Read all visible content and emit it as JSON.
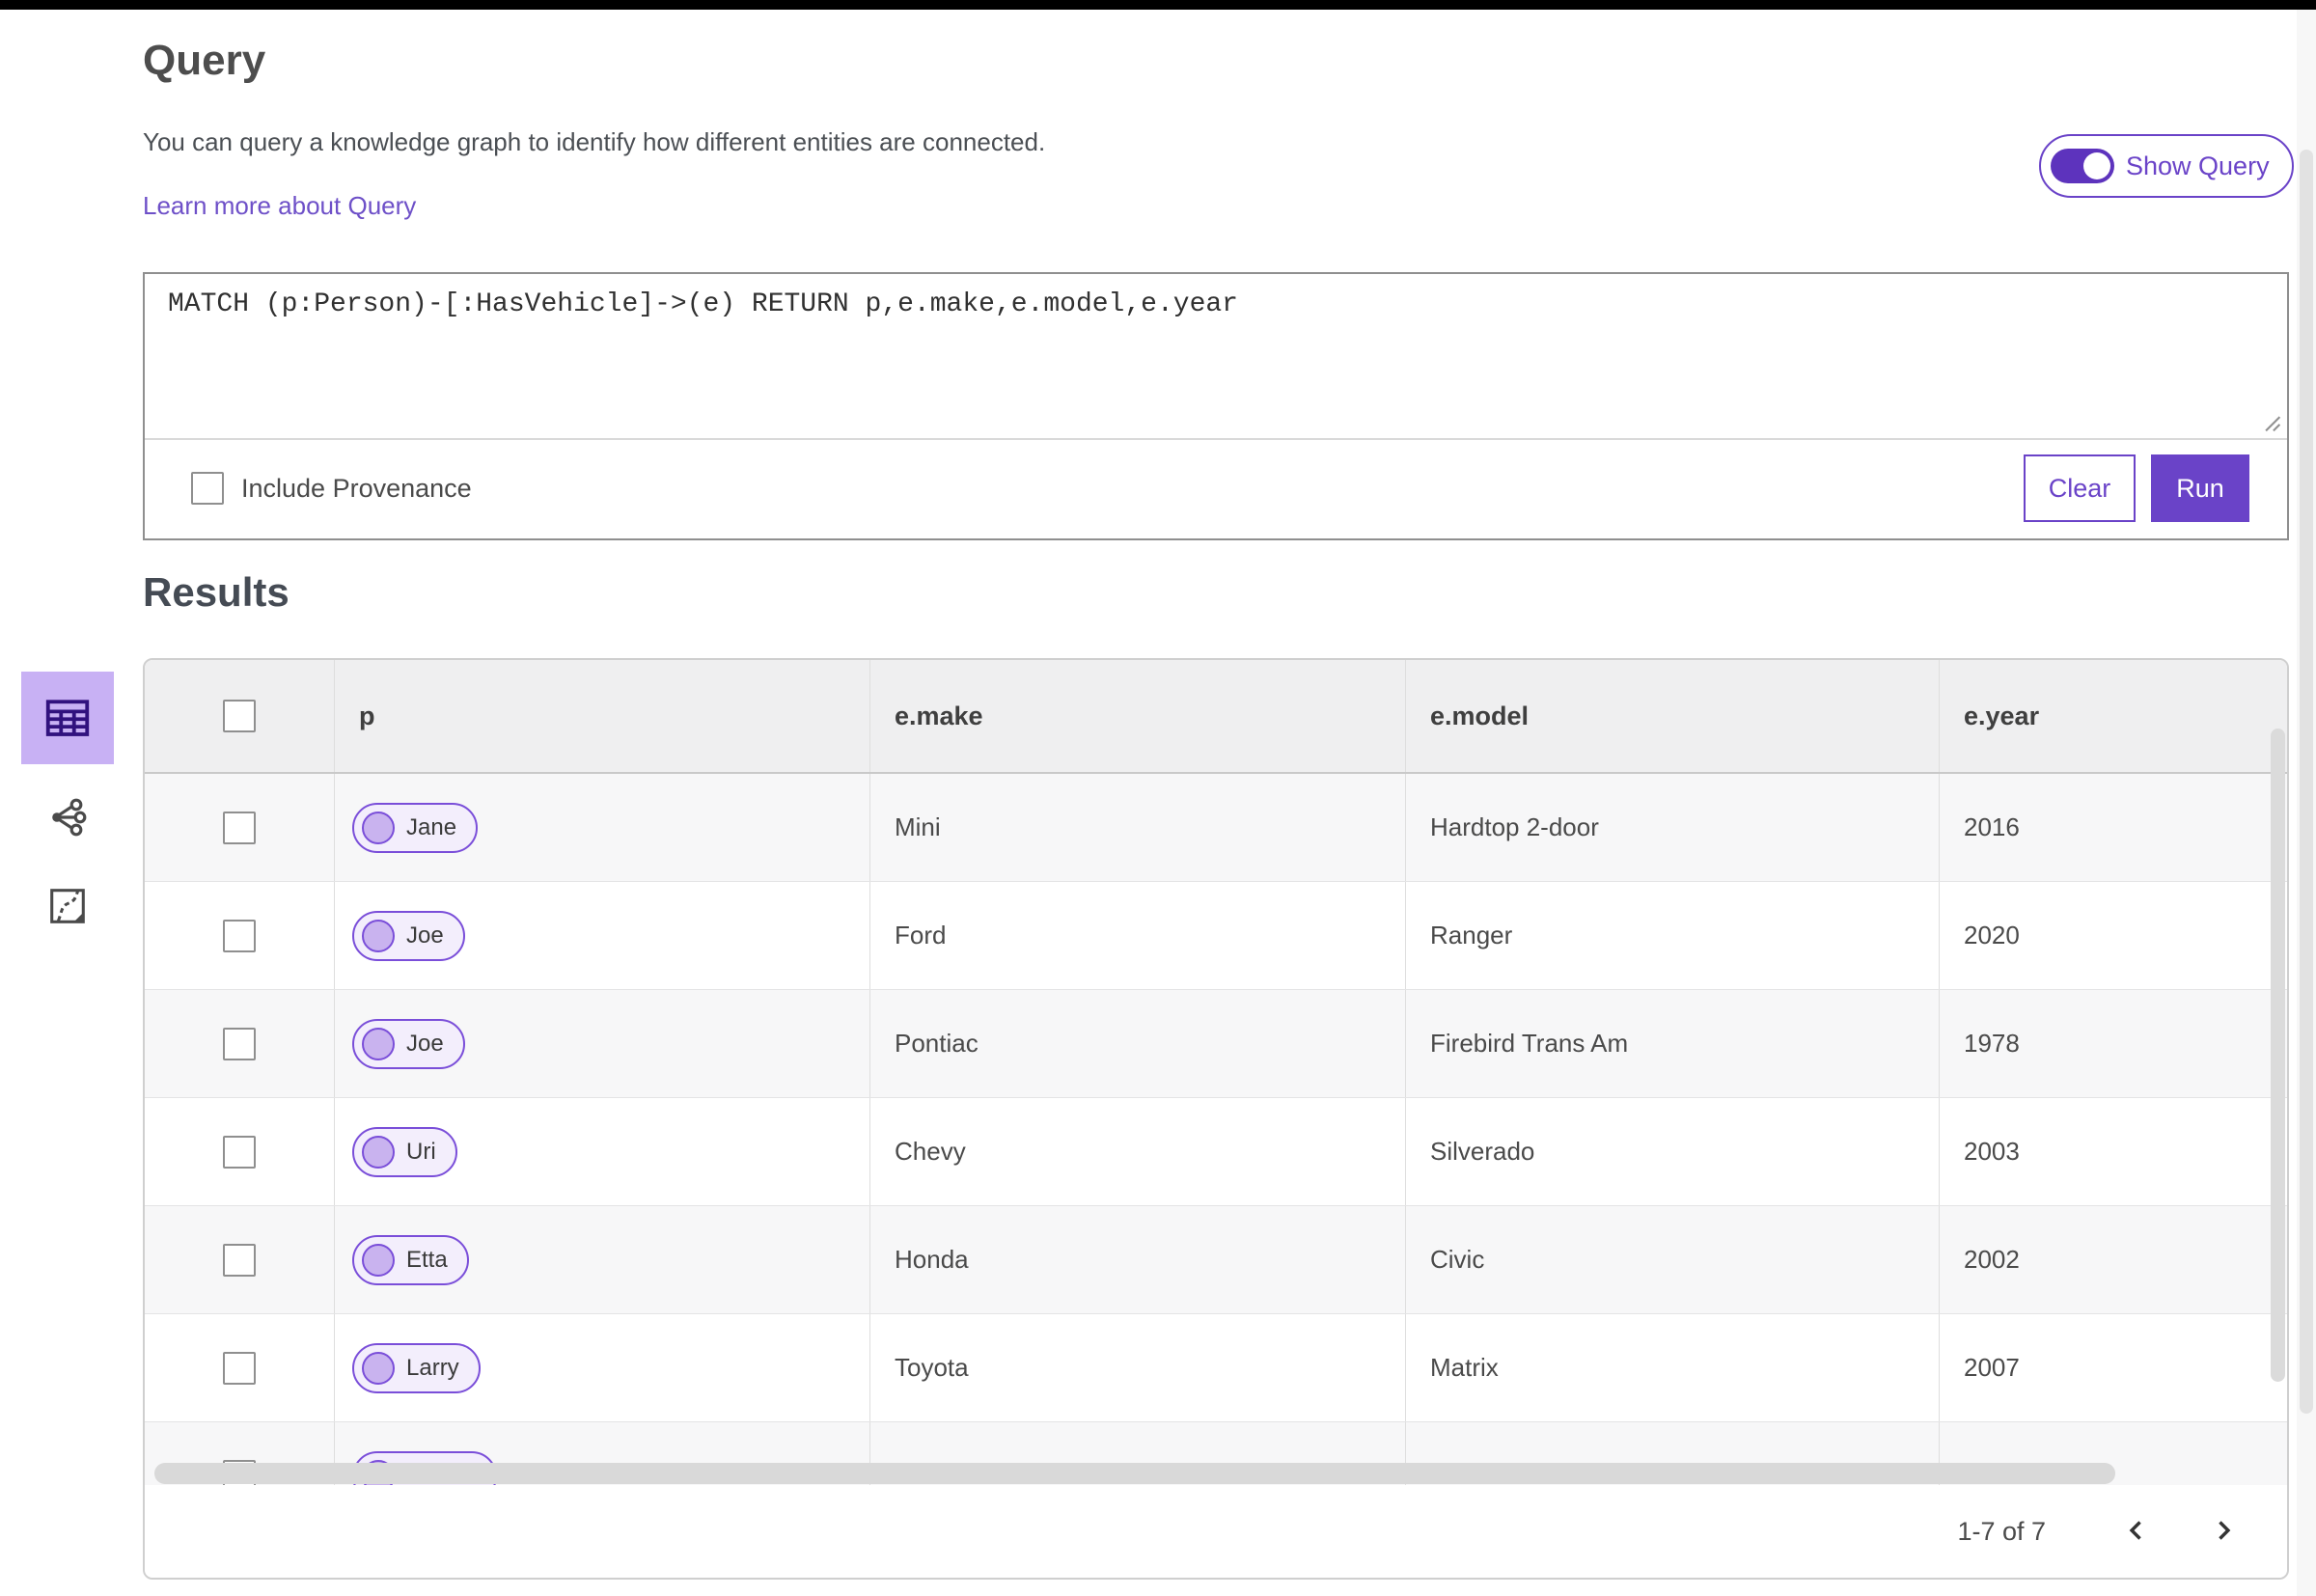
{
  "colors": {
    "accent": "#6a43c8",
    "toggle_track": "#5d33bd",
    "chip_border": "#7a4ed9",
    "chip_bg": "#f3eefc",
    "chip_circle": "#c9b3ef",
    "selected_tile_bg": "#c8b1f4",
    "selected_tile_icon": "#31127e",
    "table_header_bg": "#efeff0",
    "row_alt_bg": "#f7f7f8"
  },
  "query_section": {
    "title": "Query",
    "description": "You can query a knowledge graph to identify how different entities are connected.",
    "learn_more_link": "Learn more about Query",
    "show_query_toggle": {
      "label": "Show Query",
      "state": "on"
    },
    "editor": {
      "query_text": "MATCH (p:Person)-[:HasVehicle]->(e) RETURN p,e.make,e.model,e.year",
      "include_provenance_label": "Include Provenance",
      "include_provenance_checked": false,
      "clear_button": "Clear",
      "run_button": "Run"
    }
  },
  "results_section": {
    "title": "Results",
    "view_switcher": [
      {
        "id": "table-view",
        "icon": "table-icon",
        "selected": true
      },
      {
        "id": "graph-view",
        "icon": "link-chart-icon",
        "selected": false
      },
      {
        "id": "map-view",
        "icon": "map-icon",
        "selected": false
      }
    ],
    "table": {
      "columns": [
        "p",
        "e.make",
        "e.model",
        "e.year"
      ],
      "rows": [
        {
          "p": "Jane",
          "e_make": "Mini",
          "e_model": "Hardtop 2-door",
          "e_year": "2016"
        },
        {
          "p": "Joe",
          "e_make": "Ford",
          "e_model": "Ranger",
          "e_year": "2020"
        },
        {
          "p": "Joe",
          "e_make": "Pontiac",
          "e_model": "Firebird Trans Am",
          "e_year": "1978"
        },
        {
          "p": "Uri",
          "e_make": "Chevy",
          "e_model": "Silverado",
          "e_year": "2003"
        },
        {
          "p": "Etta",
          "e_make": "Honda",
          "e_model": "Civic",
          "e_year": "2002"
        },
        {
          "p": "Larry",
          "e_make": "Toyota",
          "e_model": "Matrix",
          "e_year": "2007"
        },
        {
          "p": "",
          "e_make": "",
          "e_model": "",
          "e_year": "",
          "partial": true
        }
      ]
    },
    "pagination": {
      "range_label": "1-7 of 7"
    }
  }
}
